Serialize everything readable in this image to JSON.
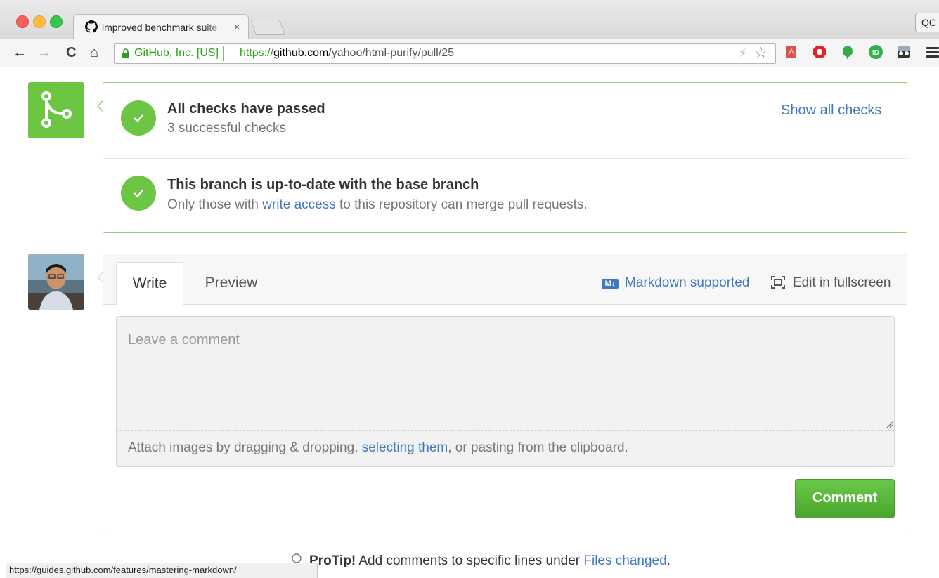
{
  "browser": {
    "tab_title": "improved benchmark suite",
    "tab_close": "×",
    "profile_label": "QC",
    "ev_label": "GitHub, Inc. [US]",
    "url_scheme": "https://",
    "url_host": "github.com",
    "url_path": "/yahoo/html-purify/pull/25",
    "nav": {
      "back": "←",
      "forward": "→",
      "reload": "C",
      "home": "⌂"
    },
    "omnibox_bolt": "⚡",
    "omnibox_star": "☆",
    "extensions": [
      "pdf-icon",
      "adblock-icon",
      "evernote-icon",
      "id-icon",
      "incognito-icon"
    ],
    "status_url": "https://guides.github.com/features/mastering-markdown/"
  },
  "merge_status": {
    "checks_title": "All checks have passed",
    "checks_subtitle": "3 successful checks",
    "show_all_link": "Show all checks",
    "branch_title": "This branch is up-to-date with the base branch",
    "branch_subtitle_pre": "Only those with ",
    "branch_subtitle_link": "write access",
    "branch_subtitle_post": " to this repository can merge pull requests.",
    "accent": "#6cc644"
  },
  "comment": {
    "tab_write": "Write",
    "tab_preview": "Preview",
    "markdown_badge": "M↓",
    "markdown_link": "Markdown supported",
    "fullscreen_label": "Edit in fullscreen",
    "placeholder": "Leave a comment",
    "attach_pre": "Attach images by dragging & dropping, ",
    "attach_link": "selecting them",
    "attach_post": ", or pasting from the clipboard.",
    "submit_label": "Comment"
  },
  "protip": {
    "label": "ProTip!",
    "text": " Add comments to specific lines under ",
    "link": "Files changed",
    "end": "."
  },
  "colors": {
    "link": "#4078c0",
    "success": "#6cc644",
    "button": "#55b535"
  }
}
